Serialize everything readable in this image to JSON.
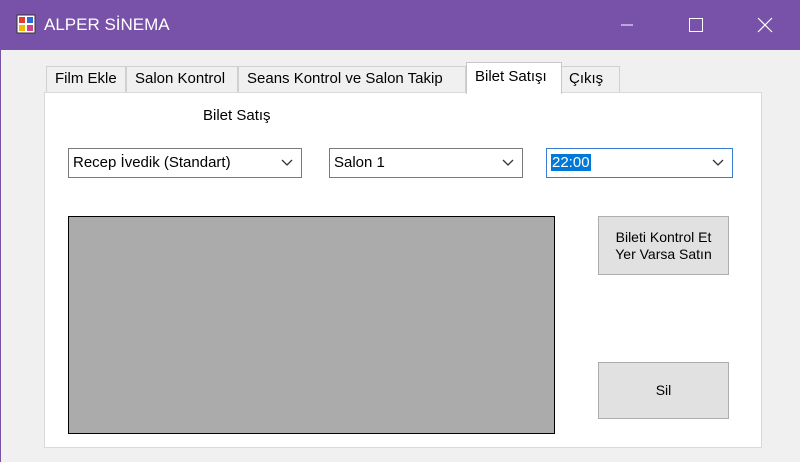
{
  "window": {
    "title": "ALPER SİNEMA"
  },
  "tabs": [
    {
      "label": "Film Ekle",
      "active": false
    },
    {
      "label": "Salon Kontrol",
      "active": false
    },
    {
      "label": "Seans Kontrol ve Salon Takip",
      "active": false
    },
    {
      "label": "Bilet Satışı",
      "active": true
    },
    {
      "label": "Çıkış",
      "active": false
    }
  ],
  "panel": {
    "heading": "Bilet Satış",
    "film_select": {
      "value": "Recep İvedik (Standart)"
    },
    "salon_select": {
      "value": "Salon 1"
    },
    "time_select": {
      "value": "22:00"
    },
    "check_button": {
      "line1": "Bileti Kontrol Et",
      "line2": "Yer Varsa Satın"
    },
    "delete_button": {
      "label": "Sil"
    }
  },
  "colors": {
    "titlebar": "#7851a9",
    "listbox": "#ababab",
    "selection": "#0078d7"
  }
}
